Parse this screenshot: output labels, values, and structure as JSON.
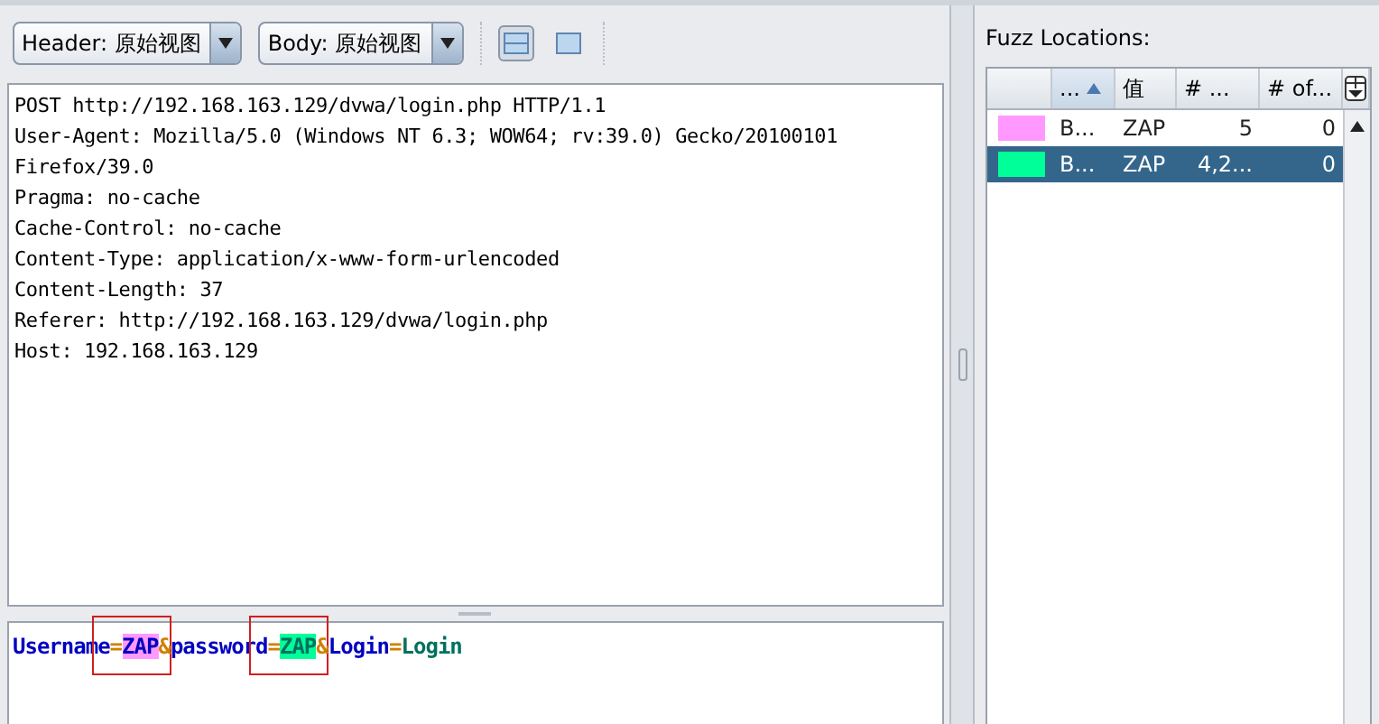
{
  "toolbar": {
    "dropdowns": [
      {
        "label": "Header: 原始视图"
      },
      {
        "label": "Body: 原始视图"
      }
    ],
    "view_buttons": [
      {
        "selected": true
      },
      {
        "selected": false
      }
    ]
  },
  "header_text": [
    "POST http://192.168.163.129/dvwa/login.php HTTP/1.1",
    "User-Agent: Mozilla/5.0 (Windows NT 6.3; WOW64; rv:39.0) Gecko/20100101",
    "Firefox/39.0",
    "Pragma: no-cache",
    "Cache-Control: no-cache",
    "Content-Type: application/x-www-form-urlencoded",
    "Content-Length: 37",
    "Referer: http://192.168.163.129/dvwa/login.php",
    "Host: 192.168.163.129"
  ],
  "body_tokens": [
    {
      "text": "Username",
      "kind": "key"
    },
    {
      "text": "=",
      "kind": "sep"
    },
    {
      "text": "ZAP",
      "kind": "key",
      "color": "#ff99ff",
      "boxed": true
    },
    {
      "text": "&",
      "kind": "sep"
    },
    {
      "text": "password",
      "kind": "key"
    },
    {
      "text": "=",
      "kind": "sep"
    },
    {
      "text": "ZAP",
      "kind": "value",
      "color": "#00ff99",
      "boxed": true
    },
    {
      "text": "&",
      "kind": "sep"
    },
    {
      "text": "Login",
      "kind": "key"
    },
    {
      "text": "=",
      "kind": "sep"
    },
    {
      "text": "Login",
      "kind": "value"
    }
  ],
  "fuzz_locations": {
    "title": "Fuzz Locations:",
    "columns": [
      {
        "label": "...",
        "sorted": true
      },
      {
        "label": "值",
        "sorted": false
      },
      {
        "label": "# ...",
        "sorted": false
      },
      {
        "label": "# of...",
        "sorted": false
      }
    ],
    "rows": [
      {
        "color": "#ff99ff",
        "cells": [
          "B...",
          "ZAP",
          "5",
          "0"
        ],
        "selected": false
      },
      {
        "color": "#00ff99",
        "cells": [
          "B...",
          "ZAP",
          "4,2...",
          "0"
        ],
        "selected": true
      }
    ]
  }
}
